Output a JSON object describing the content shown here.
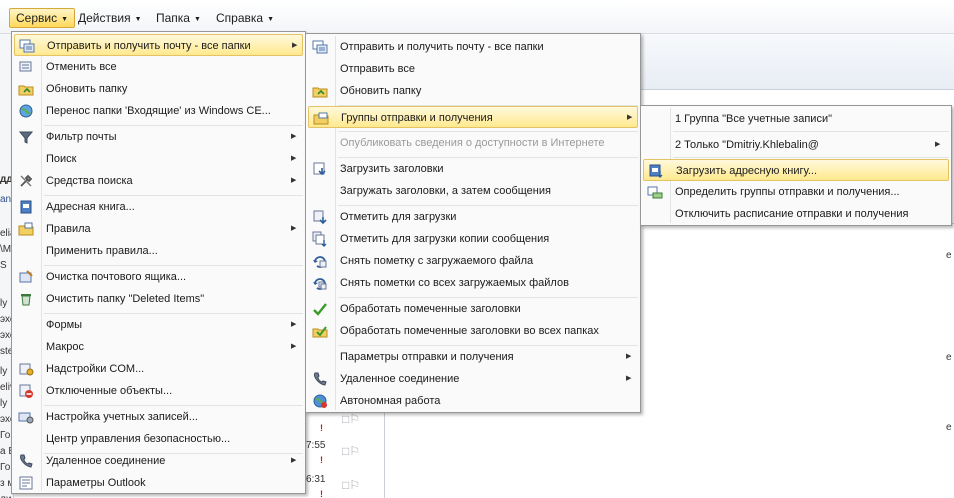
{
  "menubar": {
    "items": [
      {
        "label": "Сервис",
        "active": true
      },
      {
        "label": "Действия",
        "active": false
      },
      {
        "label": "Папка",
        "active": false
      },
      {
        "label": "Справка",
        "active": false
      }
    ]
  },
  "background": {
    "left_fragments": [
      "дд",
      "an",
      "elia",
      "\\M",
      "S",
      "ly",
      "эхе",
      "эхе",
      "ste",
      "ly",
      "eliv",
      "ly",
      "эхе",
      "Го",
      "а В",
      "Го",
      "з м",
      "ли"
    ],
    "times": [
      "7:55",
      "6:31"
    ],
    "right_fragments": [
      "е",
      "е",
      "e"
    ]
  },
  "service_menu": {
    "items": [
      {
        "label": "Отправить и получить почту - все папки",
        "icon": "send-receive-icon",
        "submenu": true,
        "highlighted": true
      },
      {
        "label": "Отменить все",
        "icon": "cancel-all-icon",
        "submenu": false
      },
      {
        "label": "Обновить папку",
        "icon": "update-folder-icon",
        "submenu": false
      },
      {
        "label": "Перенос папки 'Входящие' из Windows CE...",
        "icon": "globe-icon",
        "submenu": false
      },
      {
        "label": "Фильтр почты",
        "icon": "filter-icon",
        "submenu": true
      },
      {
        "label": "Поиск",
        "icon": "",
        "submenu": true
      },
      {
        "label": "Средства поиска",
        "icon": "tools-icon",
        "submenu": true
      },
      {
        "label": "Адресная книга...",
        "icon": "address-book-icon",
        "submenu": false
      },
      {
        "label": "Правила",
        "icon": "rules-icon",
        "submenu": true
      },
      {
        "label": "Применить правила...",
        "icon": "",
        "submenu": false
      },
      {
        "label": "Очистка почтового ящика...",
        "icon": "mailbox-cleanup-icon",
        "submenu": false
      },
      {
        "label": "Очистить папку \"Deleted Items\"",
        "icon": "recycle-icon",
        "submenu": false
      },
      {
        "label": "Формы",
        "icon": "",
        "submenu": true
      },
      {
        "label": "Макрос",
        "icon": "",
        "submenu": true
      },
      {
        "label": "Надстройки COM...",
        "icon": "com-addins-icon",
        "submenu": false
      },
      {
        "label": "Отключенные объекты...",
        "icon": "disabled-items-icon",
        "submenu": false
      },
      {
        "label": "Настройка учетных записей...",
        "icon": "account-settings-icon",
        "submenu": false
      },
      {
        "label": "Центр управления безопасностью...",
        "icon": "",
        "submenu": false
      },
      {
        "label": "Удаленное соединение",
        "icon": "phone-icon",
        "submenu": true
      },
      {
        "label": "Параметры Outlook",
        "icon": "outlook-options-icon",
        "submenu": false
      }
    ]
  },
  "send_receive_menu": {
    "items": [
      {
        "label": "Отправить и получить почту - все папки",
        "icon": "send-receive-icon",
        "submenu": false
      },
      {
        "label": "Отправить все",
        "icon": "",
        "submenu": false
      },
      {
        "label": "Обновить папку",
        "icon": "update-folder-icon",
        "submenu": false
      },
      {
        "label": "Группы отправки и получения",
        "icon": "groups-icon",
        "submenu": true,
        "highlighted": true
      },
      {
        "label": "Опубликовать сведения о доступности в Интернете",
        "icon": "",
        "submenu": false,
        "disabled": true
      },
      {
        "label": "Загрузить заголовки",
        "icon": "download-headers-icon",
        "submenu": false
      },
      {
        "label": "Загружать заголовки, а затем сообщения",
        "icon": "",
        "submenu": false
      },
      {
        "label": "Отметить для загрузки",
        "icon": "mark-download-icon",
        "submenu": false
      },
      {
        "label": "Отметить для загрузки копии сообщения",
        "icon": "mark-copy-icon",
        "submenu": false
      },
      {
        "label": "Снять пометку с загружаемого файла",
        "icon": "unmark-icon",
        "submenu": false
      },
      {
        "label": "Снять пометки со всех загружаемых файлов",
        "icon": "unmark-all-icon",
        "submenu": false
      },
      {
        "label": "Обработать помеченные заголовки",
        "icon": "check-icon",
        "submenu": false
      },
      {
        "label": "Обработать помеченные заголовки во всех папках",
        "icon": "process-all-icon",
        "submenu": false
      },
      {
        "label": "Параметры отправки и получения",
        "icon": "",
        "submenu": true
      },
      {
        "label": "Удаленное соединение",
        "icon": "phone-icon",
        "submenu": true
      },
      {
        "label": "Автономная работа",
        "icon": "offline-icon",
        "submenu": false
      }
    ]
  },
  "groups_menu": {
    "items": [
      {
        "label": "1 Группа \"Все учетные записи\"",
        "icon": "",
        "submenu": false
      },
      {
        "label": "2 Только \"Dmitriy.Khlebalin@",
        "icon": "",
        "submenu": true
      },
      {
        "label": "Загрузить адресную книгу...",
        "icon": "download-address-book-icon",
        "submenu": false,
        "highlighted": true
      },
      {
        "label": "Определить группы отправки и получения...",
        "icon": "define-groups-icon",
        "submenu": false
      },
      {
        "label": "Отключить расписание отправки и получения",
        "icon": "",
        "submenu": false
      }
    ]
  },
  "colors": {
    "highlight_top": "#fff9dc",
    "highlight_bottom": "#ffe98e",
    "highlight_border": "#e5c365",
    "menu_bg": "#fafafa",
    "menu_border": "#979797",
    "disabled_text": "#9a9a9a"
  }
}
